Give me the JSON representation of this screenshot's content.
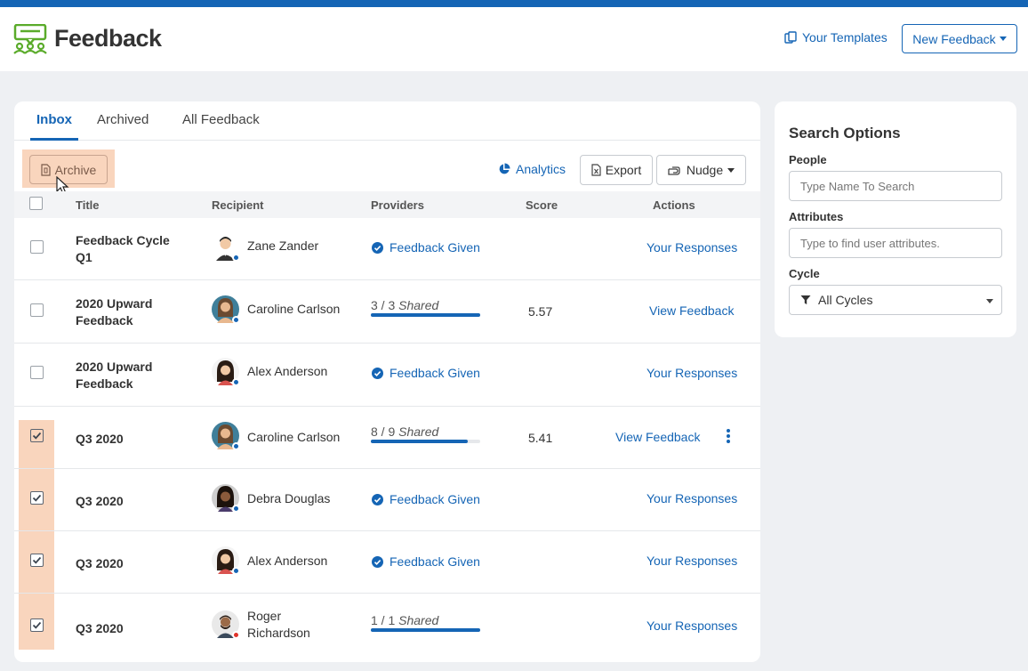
{
  "header": {
    "app_title": "Feedback",
    "templates_label": "Your Templates",
    "new_feedback_label": "New Feedback",
    "brand_color": "#1565b5",
    "logo_color": "#5aab2a"
  },
  "tabs": [
    {
      "label": "Inbox",
      "active": true
    },
    {
      "label": "Archived",
      "active": false
    },
    {
      "label": "All Feedback",
      "active": false
    }
  ],
  "toolbar": {
    "archive_label": "Archive",
    "analytics_label": "Analytics",
    "export_label": "Export",
    "nudge_label": "Nudge"
  },
  "table": {
    "headers": {
      "title": "Title",
      "recipient": "Recipient",
      "providers": "Providers",
      "score": "Score",
      "actions": "Actions"
    },
    "rows": [
      {
        "title": "Feedback Cycle Q1",
        "recipient": "Zane Zander",
        "provider_status": "Feedback Given",
        "score": "",
        "action": "Your Responses",
        "checked": false
      },
      {
        "title": "2020 Upward Feedback",
        "recipient": "Caroline Carlson",
        "shared_count": "3 / 3",
        "shared_word": "Shared",
        "shared_fraction": 1.0,
        "score": "5.57",
        "action": "View Feedback",
        "checked": false
      },
      {
        "title": "2020 Upward Feedback",
        "recipient": "Alex Anderson",
        "provider_status": "Feedback Given",
        "score": "",
        "action": "Your Responses",
        "checked": false
      },
      {
        "title": "Q3 2020",
        "recipient": "Caroline Carlson",
        "shared_count": "8 / 9",
        "shared_word": "Shared",
        "shared_fraction": 0.889,
        "score": "5.41",
        "action": "View Feedback",
        "checked": true,
        "has_menu": true
      },
      {
        "title": "Q3 2020",
        "recipient": "Debra Douglas",
        "provider_status": "Feedback Given",
        "score": "",
        "action": "Your Responses",
        "checked": true
      },
      {
        "title": "Q3 2020",
        "recipient": "Alex Anderson",
        "provider_status": "Feedback Given",
        "score": "",
        "action": "Your Responses",
        "checked": true
      },
      {
        "title": "Q3 2020",
        "recipient": "Roger Richardson",
        "shared_count": "1 / 1",
        "shared_word": "Shared",
        "shared_fraction": 1.0,
        "score": "",
        "action": "Your Responses",
        "checked": true
      }
    ]
  },
  "search_options": {
    "title": "Search Options",
    "people_label": "People",
    "people_placeholder": "Type Name To Search",
    "attributes_label": "Attributes",
    "attributes_placeholder": "Type to find user attributes.",
    "cycle_label": "Cycle",
    "cycle_value": "All Cycles"
  }
}
